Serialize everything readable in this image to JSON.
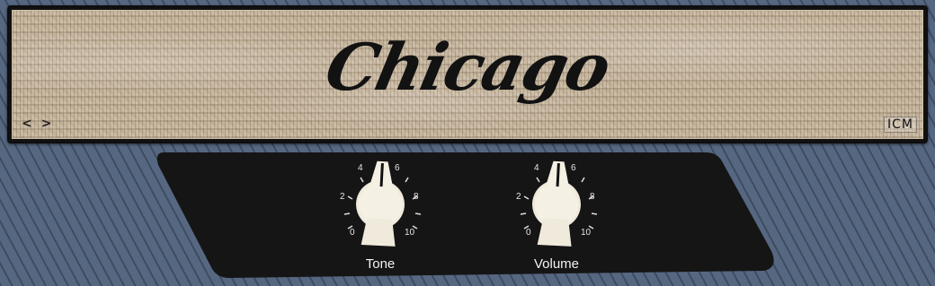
{
  "amp": {
    "name": "Chicago",
    "logo": "ICM",
    "nav": {
      "prev_icon": "<",
      "next_icon": ">"
    }
  },
  "knobs": [
    {
      "id": "tone",
      "label": "Tone",
      "value": 5.1
    },
    {
      "id": "volume",
      "label": "Volume",
      "value": 5.1
    }
  ],
  "scale_labels": {
    "l0": "0",
    "l2": "2",
    "l4": "4",
    "l6": "6",
    "l8": "8",
    "l10": "10"
  },
  "colors": {
    "panel": "#151515",
    "knob_cream": "#efeadc",
    "background": "#4a5a70",
    "grille": "#c9b9a1"
  }
}
